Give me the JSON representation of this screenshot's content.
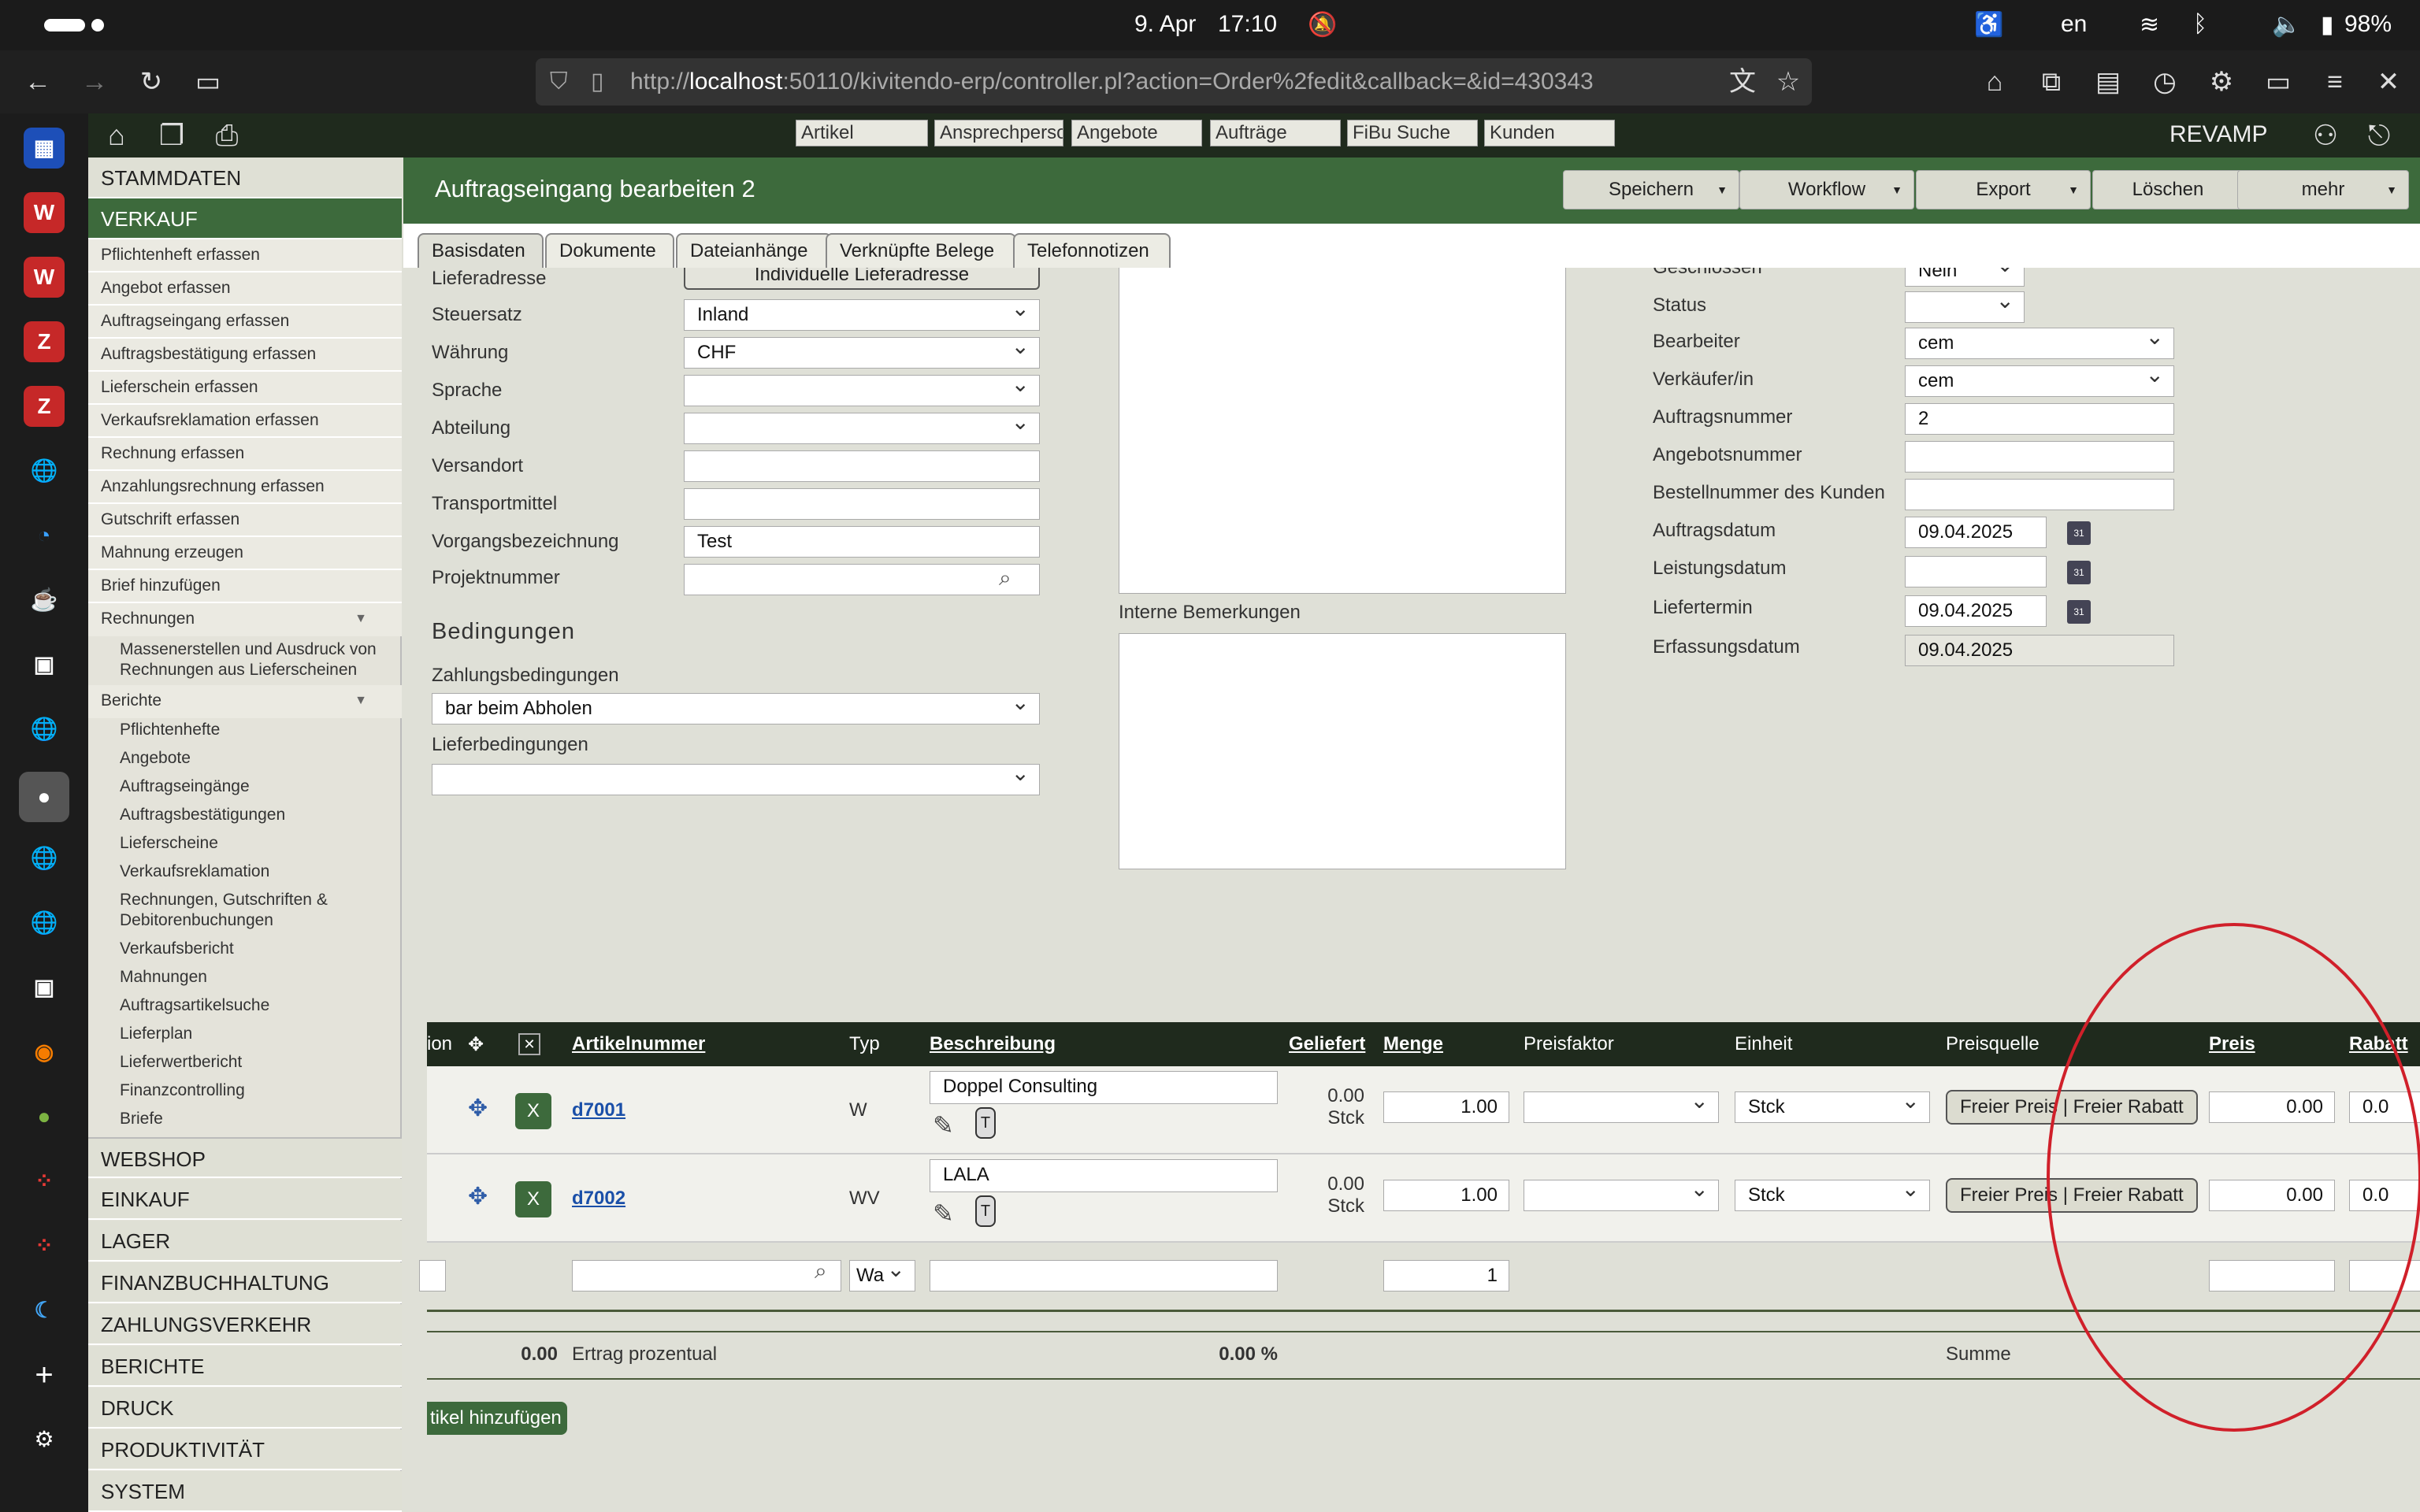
{
  "status": {
    "date": "9. Apr",
    "time": "17:10",
    "lang": "en",
    "battery": "98%"
  },
  "browser": {
    "url_prefix": "http://",
    "url_host": "localhost",
    "url_rest": ":50110/kivitendo-erp/controller.pl?action=Order%2fedit&callback=&id=430343"
  },
  "topbar": {
    "quick_search": [
      "Artikel",
      "Ansprechperso",
      "Angebote",
      "Aufträge",
      "FiBu Suche",
      "Kunden"
    ],
    "company": "REVAMP"
  },
  "menu": {
    "stammdaten": "STAMMDATEN",
    "verkauf": "VERKAUF",
    "verkauf_items": [
      "Pflichtenheft erfassen",
      "Angebot erfassen",
      "Auftragseingang erfassen",
      "Auftragsbestätigung erfassen",
      "Lieferschein erfassen",
      "Verkaufsreklamation erfassen",
      "Rechnung erfassen",
      "Anzahlungsrechnung erfassen",
      "Gutschrift erfassen",
      "Mahnung erzeugen",
      "Brief hinzufügen"
    ],
    "rechnungen": "Rechnungen",
    "rechnungen_sub": "Massenerstellen und Ausdruck von Rechnungen aus Lieferscheinen",
    "berichte": "Berichte",
    "berichte_items": [
      "Pflichtenhefte",
      "Angebote",
      "Auftragseingänge",
      "Auftragsbestätigungen",
      "Lieferscheine",
      "Verkaufsreklamation",
      "Rechnungen, Gutschriften & Debitorenbuchungen",
      "Verkaufsbericht",
      "Mahnungen",
      "Auftragsartikelsuche",
      "Lieferplan",
      "Lieferwertbericht",
      "Finanzcontrolling",
      "Briefe"
    ],
    "top": [
      "WEBSHOP",
      "EINKAUF",
      "LAGER",
      "FINANZBUCHHALTUNG",
      "ZAHLUNGSVERKEHR",
      "BERICHTE",
      "DRUCK",
      "PRODUKTIVITÄT",
      "SYSTEM"
    ]
  },
  "header": {
    "title": "Auftragseingang bearbeiten 2",
    "buttons": {
      "save": "Speichern",
      "workflow": "Workflow",
      "export": "Export",
      "delete": "Löschen",
      "more": "mehr"
    }
  },
  "tabs": [
    "Basisdaten",
    "Dokumente",
    "Dateianhänge",
    "Verknüpfte Belege",
    "Telefonnotizen"
  ],
  "form_left": {
    "lieferadresse_label": "Lieferadresse",
    "lieferadresse_button": "Individuelle Lieferadresse",
    "steuersatz_label": "Steuersatz",
    "steuersatz": "Inland",
    "waehrung_label": "Währung",
    "waehrung": "CHF",
    "sprache_label": "Sprache",
    "sprache": "",
    "abteilung_label": "Abteilung",
    "abteilung": "",
    "versandort_label": "Versandort",
    "versandort": "",
    "transportmittel_label": "Transportmittel",
    "transportmittel": "",
    "vorgang_label": "Vorgangsbezeichnung",
    "vorgang": "Test",
    "projekt_label": "Projektnummer",
    "projekt": "",
    "bedingungen_heading": "Bedingungen",
    "zahlung_label": "Zahlungsbedingungen",
    "zahlung": "bar beim Abholen",
    "liefer_label": "Lieferbedingungen",
    "liefer": ""
  },
  "form_mid": {
    "interne_label": "Interne Bemerkungen"
  },
  "form_right": {
    "geschlossen_label": "Geschlossen",
    "geschlossen": "Nein",
    "status_label": "Status",
    "status": "",
    "bearbeiter_label": "Bearbeiter",
    "bearbeiter": "cem",
    "verkaeufer_label": "Verkäufer/in",
    "verkaeufer": "cem",
    "auftragsnummer_label": "Auftragsnummer",
    "auftragsnummer": "2",
    "angebotsnummer_label": "Angebotsnummer",
    "angebotsnummer": "",
    "bestellnummer_label": "Bestellnummer des Kunden",
    "bestellnummer": "",
    "auftragsdatum_label": "Auftragsdatum",
    "auftragsdatum": "09.04.2025",
    "leistungsdatum_label": "Leistungsdatum",
    "leistungsdatum": "",
    "liefertermin_label": "Liefertermin",
    "liefertermin": "09.04.2025",
    "erfassung_label": "Erfassungsdatum",
    "erfassung": "09.04.2025"
  },
  "positions": {
    "columns": [
      "ion",
      "Artikelnummer",
      "Typ",
      "Beschreibung",
      "Geliefert",
      "Menge",
      "Preisfaktor",
      "Einheit",
      "Preisquelle",
      "Preis",
      "Rabatt"
    ],
    "rows": [
      {
        "artikel": "d7001",
        "typ": "W",
        "beschreibung": "Doppel Consulting",
        "geliefert": "0.00",
        "geliefert_unit": "Stck",
        "menge": "1.00",
        "einheit": "Stck",
        "preisquelle": "Freier Preis | Freier Rabatt",
        "preis": "0.00",
        "rabatt": "0.0"
      },
      {
        "artikel": "d7002",
        "typ": "WV",
        "beschreibung": "LALA",
        "geliefert": "0.00",
        "geliefert_unit": "Stck",
        "menge": "1.00",
        "einheit": "Stck",
        "preisquelle": "Freier Preis | Freier Rabatt",
        "preis": "0.00",
        "rabatt": "0.0"
      }
    ],
    "new_row": {
      "typ": "Wa",
      "menge": "1"
    },
    "summary": {
      "ertrag_value": "0.00",
      "ertrag_label": "Ertrag prozentual",
      "ertrag_pct": "0.00 %",
      "summe": "Summe"
    },
    "add_button": "tikel hinzufügen"
  }
}
